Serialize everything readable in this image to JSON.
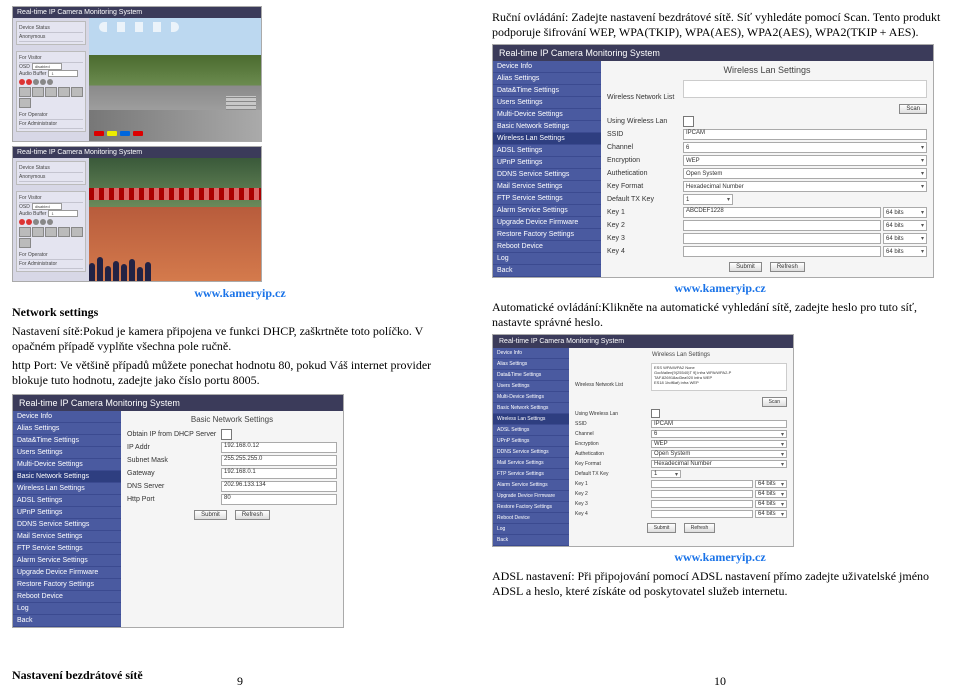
{
  "brand_url": "www.kameryip.cz",
  "left": {
    "heading": "Network settings",
    "p1": "Nastavení sítě:Pokud je kamera připojena ve funkci DHCP, zaškrtněte toto políčko. V opačném případě vyplňte všechna pole ručně.",
    "p2": "http Port: Ve většině případů můžete ponechat hodnotu 80, pokud Váš internet provider blokuje tuto hodnotu, zadejte jako číslo portu 8005.",
    "section_bottom": "Nastavení bezdrátové sítě",
    "page_num": "9"
  },
  "right": {
    "p1": "Ruční ovládání: Zadejte nastavení bezdrátové sítě. Síť vyhledáte pomocí Scan. Tento produkt podporuje šifrování WEP, WPA(TKIP), WPA(AES), WPA2(AES), WPA2(TKIP + AES).",
    "p2": "Automatické ovládání:Klikněte na automatické vyhledání sítě, zadejte heslo pro tuto síť, nastavte správné heslo.",
    "p3": "ADSL nastavení: Při připojování pomocí ADSL nastavení přímo zadejte uživatelské jméno ADSL a heslo, které získáte od poskytovatel služeb internetu.",
    "page_num": "10"
  },
  "app": {
    "title": "Real-time IP Camera Monitoring System",
    "side_device_status": "Device Status",
    "side_anonymous": "Anonymous",
    "side_for_visitor": "For Visitor",
    "side_for_admin": "For Administrator",
    "osd_label": "OSD",
    "osd_value": "disabled",
    "audio_label": "Audio Buffer",
    "audio_value": "1",
    "menu": [
      "Device Info",
      "Alias Settings",
      "Data&Time Settings",
      "Users Settings",
      "Multi-Device Settings",
      "Basic Network Settings",
      "Wireless Lan Settings",
      "ADSL Settings",
      "UPnP Settings",
      "DDNS Service Settings",
      "Mail Service Settings",
      "FTP Service Settings",
      "Alarm Service Settings",
      "Upgrade Device Firmware",
      "Restore Factory Settings",
      "Reboot Device",
      "Log",
      "Back"
    ]
  },
  "wireless": {
    "title": "Wireless Lan Settings",
    "netlist_label": "Wireless Network List",
    "scan_btn": "Scan",
    "rows": {
      "using": "Using Wireless Lan",
      "ssid_label": "SSID",
      "ssid_value": "IPCAM",
      "channel_label": "Channel",
      "channel_value": "6",
      "enc_label": "Encryption",
      "enc_value": "WEP",
      "auth_label": "Authetication",
      "auth_value": "Open System",
      "keyfmt_label": "Key Format",
      "keyfmt_value": "Hexadecimal Number",
      "defkey_label": "Default TX Key",
      "defkey_value": "1",
      "key1_label": "Key 1",
      "key1_value": "ABCDEF1228",
      "key2_label": "Key 2",
      "key3_label": "Key 3",
      "key4_label": "Key 4",
      "bits": "64 bits"
    },
    "netlist_entries": [
      "ESS WPA/WPA2 None",
      "GodVallen[9(25540)T 9] infra WPA/WPA2-P",
      "TAF.826918ad3ea920 infra WEP",
      "ES18 1hdf6af) infra WEP"
    ],
    "submit": "Submit",
    "refresh": "Refresh"
  },
  "basic_net": {
    "title": "Basic Network Settings",
    "dhcp_label": "Obtain IP from DHCP Server",
    "rows": [
      {
        "label": "IP Addr",
        "value": "192.168.0.12"
      },
      {
        "label": "Subnet Mask",
        "value": "255.255.255.0"
      },
      {
        "label": "Gateway",
        "value": "192.168.0.1"
      },
      {
        "label": "DNS Server",
        "value": "202.96.133.134"
      },
      {
        "label": "Http Port",
        "value": "80"
      }
    ],
    "submit": "Submit",
    "refresh": "Refresh"
  }
}
